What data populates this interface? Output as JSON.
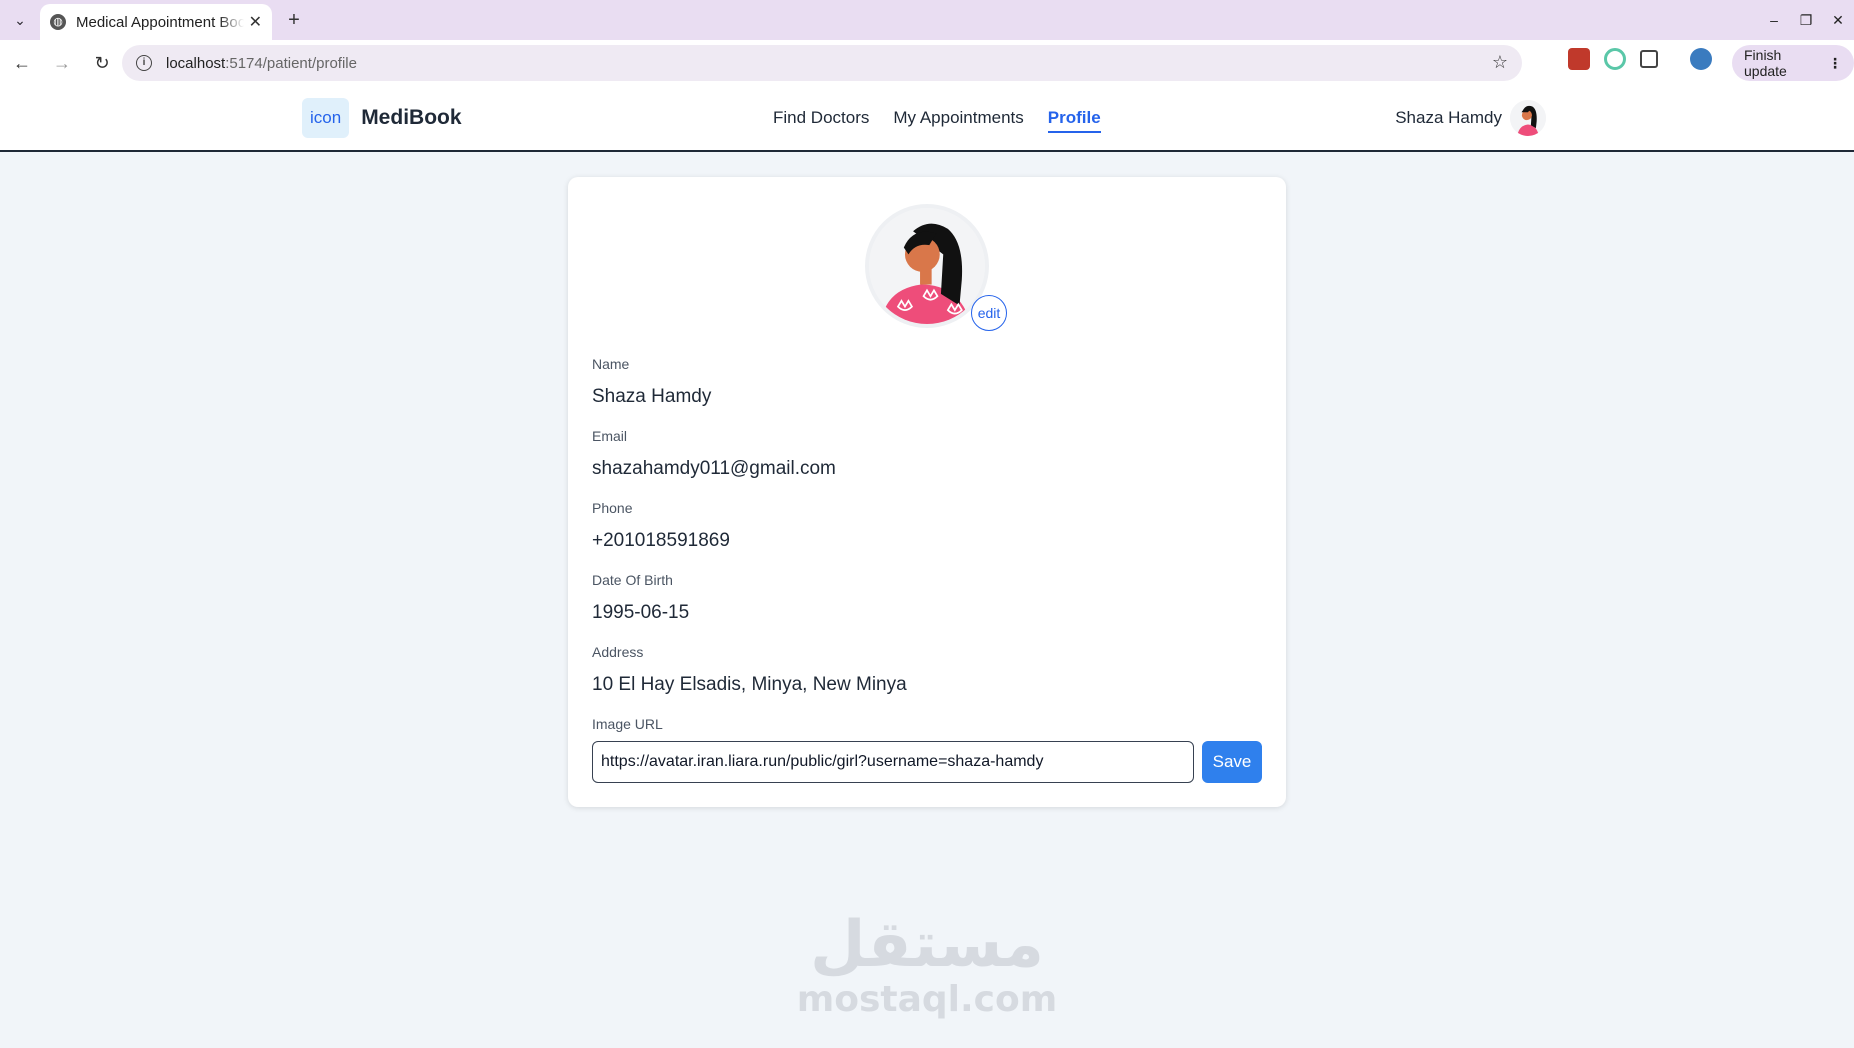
{
  "browser": {
    "tab_title": "Medical Appointment Booking",
    "tab_close": "✕",
    "new_tab": "+",
    "url_host": "localhost",
    "url_path": ":5174/patient/profile",
    "update_button": "Finish update",
    "update_menu": "⋮",
    "tab_menu": "⌄",
    "window_controls": [
      "–",
      "❐",
      "✕"
    ]
  },
  "header": {
    "logo_icon_text": "icon",
    "brand": "MediBook",
    "nav": [
      "Find Doctors",
      "My Appointments",
      "Profile"
    ],
    "active_nav": "Profile",
    "user_name": "Shaza Hamdy"
  },
  "profile": {
    "edit_label": "edit",
    "fields": [
      {
        "label": "Name",
        "value": "Shaza Hamdy"
      },
      {
        "label": "Email",
        "value": "shazahamdy011@gmail.com"
      },
      {
        "label": "Phone",
        "value": "+201018591869"
      },
      {
        "label": "Date Of Birth",
        "value": "1995-06-15"
      },
      {
        "label": "Address",
        "value": "10 El Hay Elsadis, Minya, New Minya"
      }
    ],
    "image_url_label": "Image URL",
    "image_url_value": "https://avatar.iran.liara.run/public/girl?username=shaza-hamdy",
    "save_label": "Save"
  },
  "watermark": {
    "arabic": "مستقل",
    "latin": "mostaql.com"
  },
  "colors": {
    "accent": "#2563eb",
    "save_button": "#2f80ed",
    "page_bg": "#f1f5f9",
    "tabstrip_bg": "#e9ddf2"
  }
}
